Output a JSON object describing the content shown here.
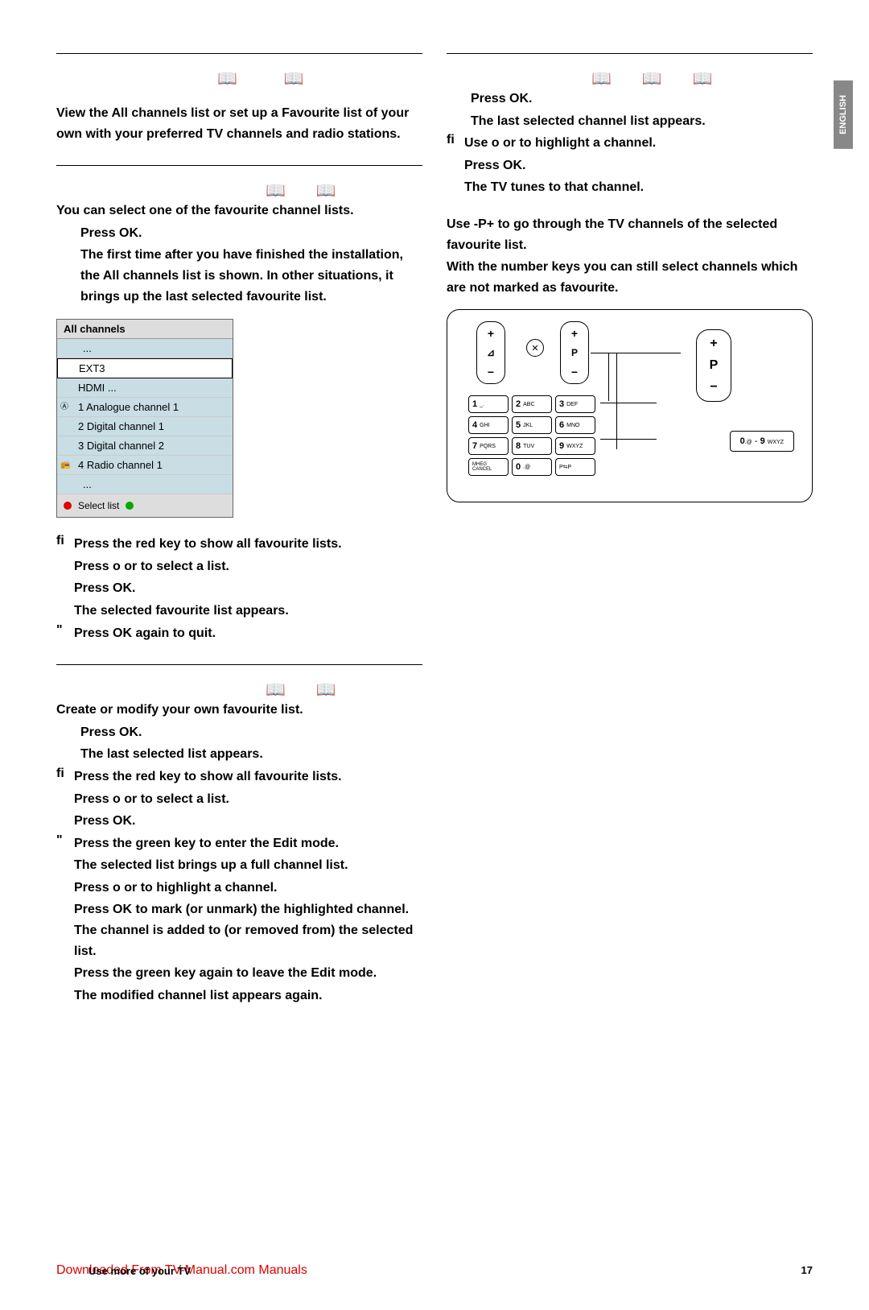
{
  "langTab": "ENGLISH",
  "leftIntro": {
    "s53": {
      "text": "View the All channels list or set up a Favourite list of your own with your preferred TV channels and radio stations."
    },
    "s531": {
      "heading": "You can select one of the favourite channel lists.",
      "step1a": "Press ",
      "ok": "OK",
      "step1b": ".",
      "step1c": "The first time after you have finished the installation, the All channels list is shown. In other situations, it brings up the last selected favourite list.",
      "fi2": "Press the red key to show all favourite lists.",
      "fi2b": "Press o  or     to select a list.",
      "fi2c": "Press ",
      "fi2d": "The selected favourite list appears.",
      "quo3": "Press ",
      "quo3b": " again to quit."
    },
    "s532": {
      "intro": "Create or modify your own favourite list.",
      "a1": "Press ",
      "a2": "The last selected list appears.",
      "fi1": "Press the red key to show all favourite lists.",
      "fi2": "Press o  or     to select a list.",
      "fi3": "Press ",
      "q1": "Press the green key to enter the Edit mode.",
      "q2": "The selected list brings up a full channel list.",
      "q3": "Press o  or     to highlight a channel.",
      "q4a": "Press ",
      "q4b": " to mark (or unmark) the highlighted channel. The channel is added to (or removed from) the selected list.",
      "q5": "Press the green key again to leave the Edit mode.",
      "q6": "The modified channel list appears again."
    }
  },
  "menu": {
    "title": "All channels",
    "r0": "...",
    "r1": "EXT3",
    "r2": "HDMI ...",
    "r3": "1 Analogue channel 1",
    "r4": "2 Digital channel 1",
    "r5": "3 Digital channel 2",
    "r6": "4 Radio channel 1",
    "r7": "...",
    "footer": "Select list"
  },
  "rightCol": {
    "a1": "Press ",
    "a2": "The last selected channel list appears.",
    "a3a": "Use o  or     to highlight a channel.",
    "a4": "Press ",
    "a5": "The TV tunes to that channel.",
    "tip1": "Use -P+ to go through the TV channels of the selected favourite list.",
    "tip2": "With the number keys you can still select channels which are not marked as favourite."
  },
  "keypad": {
    "k1": {
      "n": "1",
      "l": "_."
    },
    "k2": {
      "n": "2",
      "l": "ABC"
    },
    "k3": {
      "n": "3",
      "l": "DEF"
    },
    "k4": {
      "n": "4",
      "l": "GHI"
    },
    "k5": {
      "n": "5",
      "l": "JKL"
    },
    "k6": {
      "n": "6",
      "l": "MNO"
    },
    "k7": {
      "n": "7",
      "l": "PQRS"
    },
    "k8": {
      "n": "8",
      "l": "TUV"
    },
    "k9": {
      "n": "9",
      "l": "WXYZ"
    },
    "km": {
      "n": "",
      "l": "MHEG CANCEL"
    },
    "k0": {
      "n": "0",
      "l": ".@"
    },
    "kp": {
      "n": "",
      "l": "P⇆P"
    }
  },
  "bigKey": {
    "zero": "0",
    "zeroL": ".@",
    "dash": " - ",
    "nine": "9",
    "nineL": "WXYZ"
  },
  "rocker": {
    "plus": "+",
    "minus": "−",
    "vol": "⊿",
    "p": "P"
  },
  "footer": {
    "dl": "Downloaded From TV-Manual.com Manuals",
    "use": "Use more of your TV",
    "page": "17"
  },
  "glyphs": {
    "book": "⌂⌂"
  }
}
